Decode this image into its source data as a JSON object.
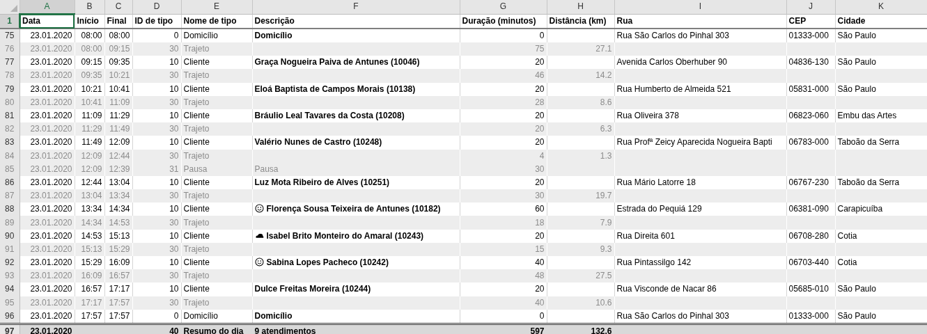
{
  "columns": [
    {
      "letter": "A",
      "selected": true
    },
    {
      "letter": "B",
      "selected": false
    },
    {
      "letter": "C",
      "selected": false
    },
    {
      "letter": "D",
      "selected": false
    },
    {
      "letter": "E",
      "selected": false
    },
    {
      "letter": "F",
      "selected": false
    },
    {
      "letter": "G",
      "selected": false
    },
    {
      "letter": "H",
      "selected": false
    },
    {
      "letter": "I",
      "selected": false
    },
    {
      "letter": "J",
      "selected": false
    },
    {
      "letter": "K",
      "selected": false
    }
  ],
  "header": {
    "row": "1",
    "selected": true,
    "cells": [
      "Data",
      "Início",
      "Final",
      "ID de tipo",
      "Nome de tipo",
      "Descrição",
      "Duração (minutos)",
      "Distância (km)",
      "Rua",
      "CEP",
      "Cidade"
    ]
  },
  "rows": [
    {
      "row": "75",
      "muted": false,
      "cells": {
        "data": "23.01.2020",
        "inicio": "08:00",
        "final": "08:00",
        "id_tipo": "0",
        "nome_tipo": "Domicílio",
        "descricao": "Domicílio",
        "duracao": "0",
        "rua": "Rua São Carlos do Pinhal 303",
        "cep": "01333-000",
        "cidade": "São Paulo"
      }
    },
    {
      "row": "76",
      "muted": true,
      "cells": {
        "data": "23.01.2020",
        "inicio": "08:00",
        "final": "09:15",
        "id_tipo": "30",
        "nome_tipo": "Trajeto",
        "duracao": "75",
        "distancia": "27.1"
      }
    },
    {
      "row": "77",
      "muted": false,
      "cells": {
        "data": "23.01.2020",
        "inicio": "09:15",
        "final": "09:35",
        "id_tipo": "10",
        "nome_tipo": "Cliente",
        "descricao": "Graça Nogueira Paiva de Antunes (10046)",
        "duracao": "20",
        "rua": "Avenida Carlos Oberhuber 90",
        "cep": "04836-130",
        "cidade": "São Paulo"
      }
    },
    {
      "row": "78",
      "muted": true,
      "cells": {
        "data": "23.01.2020",
        "inicio": "09:35",
        "final": "10:21",
        "id_tipo": "30",
        "nome_tipo": "Trajeto",
        "duracao": "46",
        "distancia": "14.2"
      }
    },
    {
      "row": "79",
      "muted": false,
      "cells": {
        "data": "23.01.2020",
        "inicio": "10:21",
        "final": "10:41",
        "id_tipo": "10",
        "nome_tipo": "Cliente",
        "descricao": "Eloá Baptista de Campos Morais (10138)",
        "duracao": "20",
        "rua": "Rua Humberto de Almeida 521",
        "cep": "05831-000",
        "cidade": "São Paulo"
      }
    },
    {
      "row": "80",
      "muted": true,
      "cells": {
        "data": "23.01.2020",
        "inicio": "10:41",
        "final": "11:09",
        "id_tipo": "30",
        "nome_tipo": "Trajeto",
        "duracao": "28",
        "distancia": "8.6"
      }
    },
    {
      "row": "81",
      "muted": false,
      "cells": {
        "data": "23.01.2020",
        "inicio": "11:09",
        "final": "11:29",
        "id_tipo": "10",
        "nome_tipo": "Cliente",
        "descricao": "Bráulio Leal Tavares da Costa (10208)",
        "duracao": "20",
        "rua": "Rua Oliveira 378",
        "cep": "06823-060",
        "cidade": "Embu das Artes"
      }
    },
    {
      "row": "82",
      "muted": true,
      "cells": {
        "data": "23.01.2020",
        "inicio": "11:29",
        "final": "11:49",
        "id_tipo": "30",
        "nome_tipo": "Trajeto",
        "duracao": "20",
        "distancia": "6.3"
      }
    },
    {
      "row": "83",
      "muted": false,
      "cells": {
        "data": "23.01.2020",
        "inicio": "11:49",
        "final": "12:09",
        "id_tipo": "10",
        "nome_tipo": "Cliente",
        "descricao": "Valério Nunes de Castro (10248)",
        "duracao": "20",
        "rua": "Rua Profª Zeicy Aparecida Nogueira Bapti",
        "cep": "06783-000",
        "cidade": "Taboão da Serra"
      }
    },
    {
      "row": "84",
      "muted": true,
      "cells": {
        "data": "23.01.2020",
        "inicio": "12:09",
        "final": "12:44",
        "id_tipo": "30",
        "nome_tipo": "Trajeto",
        "duracao": "4",
        "distancia": "1.3"
      }
    },
    {
      "row": "85",
      "muted": true,
      "cells": {
        "data": "23.01.2020",
        "inicio": "12:09",
        "final": "12:39",
        "id_tipo": "31",
        "nome_tipo": "Pausa",
        "descricao": "Pausa",
        "duracao": "30"
      }
    },
    {
      "row": "86",
      "muted": false,
      "cells": {
        "data": "23.01.2020",
        "inicio": "12:44",
        "final": "13:04",
        "id_tipo": "10",
        "nome_tipo": "Cliente",
        "descricao": "Luz Mota Ribeiro de Alves (10251)",
        "duracao": "20",
        "rua": "Rua Mário Latorre 18",
        "cep": "06767-230",
        "cidade": "Taboão da Serra"
      }
    },
    {
      "row": "87",
      "muted": true,
      "cells": {
        "data": "23.01.2020",
        "inicio": "13:04",
        "final": "13:34",
        "id_tipo": "30",
        "nome_tipo": "Trajeto",
        "duracao": "30",
        "distancia": "19.7"
      }
    },
    {
      "row": "88",
      "muted": false,
      "kind": "smiley",
      "cells": {
        "data": "23.01.2020",
        "inicio": "13:34",
        "final": "14:34",
        "id_tipo": "10",
        "nome_tipo": "Cliente",
        "descricao": "Florença Sousa Teixeira de Antunes (10182)",
        "duracao": "60",
        "rua": "Estrada do Pequiá 129",
        "cep": "06381-090",
        "cidade": "Carapicuíba"
      }
    },
    {
      "row": "89",
      "muted": true,
      "cells": {
        "data": "23.01.2020",
        "inicio": "14:34",
        "final": "14:53",
        "id_tipo": "30",
        "nome_tipo": "Trajeto",
        "duracao": "18",
        "distancia": "7.9"
      }
    },
    {
      "row": "90",
      "muted": false,
      "kind": "cloud",
      "cells": {
        "data": "23.01.2020",
        "inicio": "14:53",
        "final": "15:13",
        "id_tipo": "10",
        "nome_tipo": "Cliente",
        "descricao": "Isabel Brito Monteiro do Amaral (10243)",
        "duracao": "20",
        "rua": "Rua Direita 601",
        "cep": "06708-280",
        "cidade": "Cotia"
      }
    },
    {
      "row": "91",
      "muted": true,
      "cells": {
        "data": "23.01.2020",
        "inicio": "15:13",
        "final": "15:29",
        "id_tipo": "30",
        "nome_tipo": "Trajeto",
        "duracao": "15",
        "distancia": "9.3"
      }
    },
    {
      "row": "92",
      "muted": false,
      "kind": "smiley",
      "cells": {
        "data": "23.01.2020",
        "inicio": "15:29",
        "final": "16:09",
        "id_tipo": "10",
        "nome_tipo": "Cliente",
        "descricao": "Sabina Lopes Pacheco (10242)",
        "duracao": "40",
        "rua": "Rua Pintassilgo 142",
        "cep": "06703-440",
        "cidade": "Cotia"
      }
    },
    {
      "row": "93",
      "muted": true,
      "cells": {
        "data": "23.01.2020",
        "inicio": "16:09",
        "final": "16:57",
        "id_tipo": "30",
        "nome_tipo": "Trajeto",
        "duracao": "48",
        "distancia": "27.5"
      }
    },
    {
      "row": "94",
      "muted": false,
      "cells": {
        "data": "23.01.2020",
        "inicio": "16:57",
        "final": "17:17",
        "id_tipo": "10",
        "nome_tipo": "Cliente",
        "descricao": "Dulce Freitas Moreira (10244)",
        "duracao": "20",
        "rua": "Rua Visconde de Nacar 86",
        "cep": "05685-010",
        "cidade": "São Paulo"
      }
    },
    {
      "row": "95",
      "muted": true,
      "cells": {
        "data": "23.01.2020",
        "inicio": "17:17",
        "final": "17:57",
        "id_tipo": "30",
        "nome_tipo": "Trajeto",
        "duracao": "40",
        "distancia": "10.6"
      }
    },
    {
      "row": "96",
      "muted": false,
      "cells": {
        "data": "23.01.2020",
        "inicio": "17:57",
        "final": "17:57",
        "id_tipo": "0",
        "nome_tipo": "Domicílio",
        "descricao": "Domicílio",
        "duracao": "0",
        "rua": "Rua São Carlos do Pinhal 303",
        "cep": "01333-000",
        "cidade": "São Paulo"
      }
    }
  ],
  "summary": {
    "row": "97",
    "cells": {
      "data": "23.01.2020",
      "id_tipo": "40",
      "nome_tipo": "Resumo do dia",
      "descricao": "9 atendimentos",
      "duracao": "597",
      "distancia": "132.6"
    }
  }
}
